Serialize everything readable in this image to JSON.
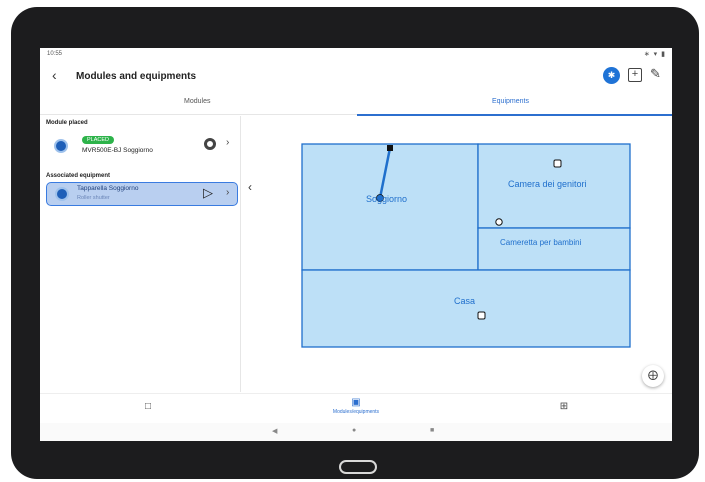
{
  "status_bar": {
    "time": "10:55",
    "right_icons": "∗ ▾ ▮"
  },
  "app_bar": {
    "back_icon": "arrow-left-icon",
    "title": "Modules and equipments"
  },
  "tabs": [
    {
      "label": "Modules",
      "active": false
    },
    {
      "label": "Equipments",
      "active": true
    }
  ],
  "left_panel": {
    "module_section": "Module placed",
    "module": {
      "badge": "PLACED",
      "name": "MVR500E-BJ Soggiorno"
    },
    "equipment_section": "Associated equipment",
    "equipment": {
      "name": "Tapparella Soggiorno",
      "type": "Roller shutter"
    }
  },
  "map": {
    "rooms": [
      {
        "label": "Soggiorno"
      },
      {
        "label": "Camera dei genitori"
      },
      {
        "label": "Cameretta per bambini"
      },
      {
        "label": "Casa"
      }
    ]
  },
  "bottom_nav": [
    {
      "icon": "device-icon",
      "label": ""
    },
    {
      "icon": "map-icon",
      "label": "Modules/equipments"
    },
    {
      "icon": "grid-icon",
      "label": ""
    }
  ],
  "colors": {
    "accent": "#2c6fcf",
    "room_fill": "#bde0f7",
    "room_stroke": "#1f6fcc",
    "placed_green": "#2db34a"
  }
}
